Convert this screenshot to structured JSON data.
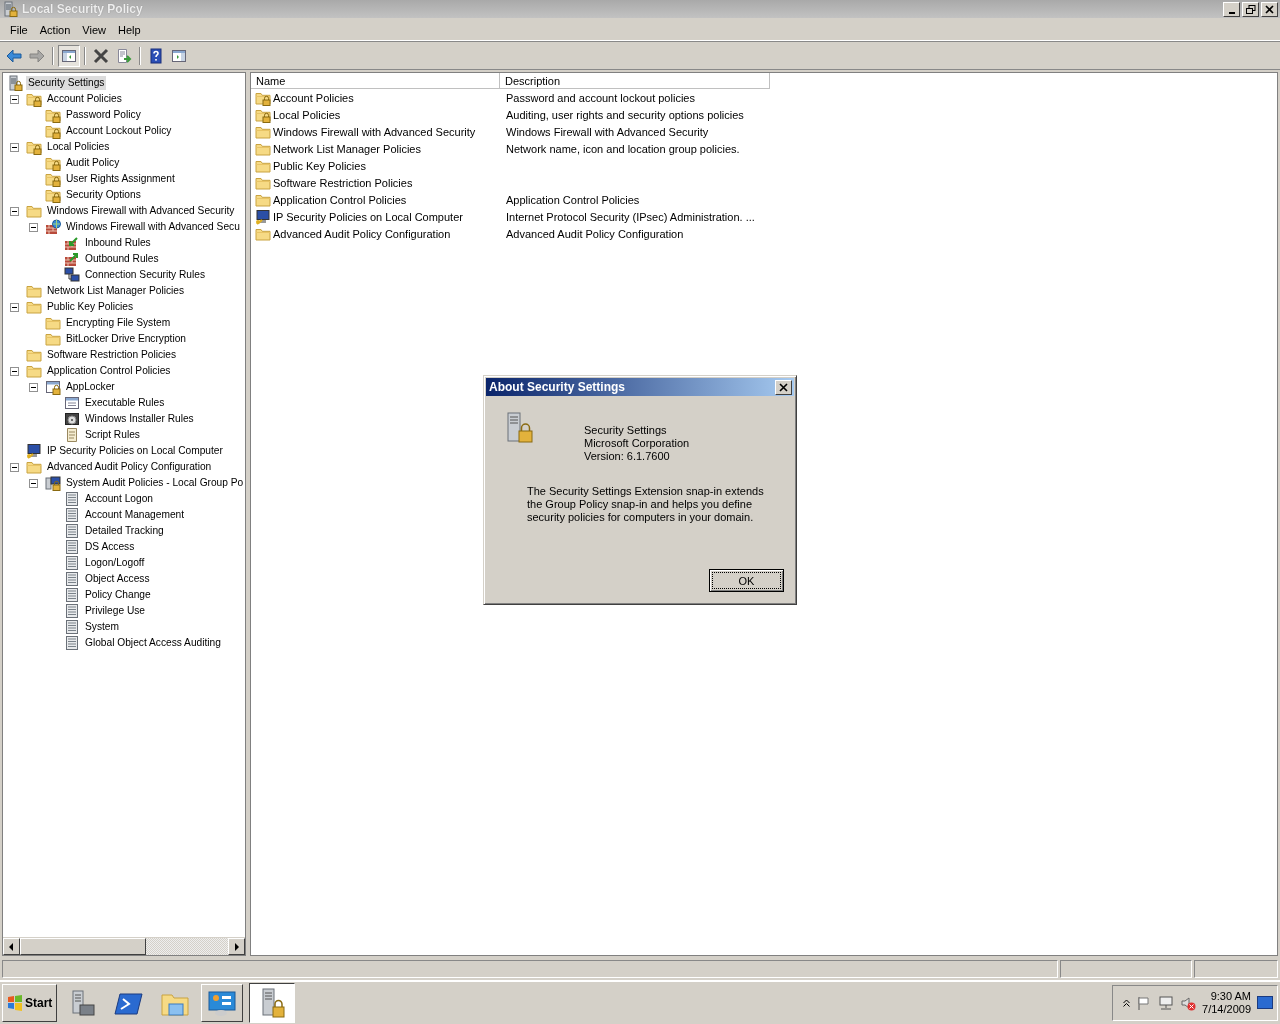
{
  "window": {
    "title": "Local Security Policy"
  },
  "menu": [
    {
      "label": "File"
    },
    {
      "label": "Action"
    },
    {
      "label": "View"
    },
    {
      "label": "Help"
    }
  ],
  "toolbar": [
    {
      "kind": "back",
      "disabled": false,
      "pressed": false
    },
    {
      "kind": "forward",
      "disabled": true,
      "pressed": false
    },
    {
      "kind": "console-tree",
      "disabled": false,
      "pressed": true
    },
    {
      "kind": "delete",
      "disabled": false,
      "pressed": false
    },
    {
      "kind": "export",
      "disabled": false,
      "pressed": false
    },
    {
      "kind": "help",
      "disabled": false,
      "pressed": false
    },
    {
      "kind": "action-pane",
      "disabled": false,
      "pressed": false
    }
  ],
  "tree": [
    {
      "label": "Security Settings",
      "kind": "root",
      "selected": true,
      "children": [
        {
          "label": "Account Policies",
          "kind": "lock-folder",
          "expanded": true,
          "selected": false,
          "children": [
            {
              "label": "Password Policy",
              "kind": "lock-folder",
              "selected": false
            },
            {
              "label": "Account Lockout Policy",
              "kind": "lock-folder",
              "selected": false
            }
          ]
        },
        {
          "label": "Local Policies",
          "kind": "lock-folder",
          "expanded": true,
          "selected": false,
          "children": [
            {
              "label": "Audit Policy",
              "kind": "lock-folder",
              "selected": false
            },
            {
              "label": "User Rights Assignment",
              "kind": "lock-folder",
              "selected": false
            },
            {
              "label": "Security Options",
              "kind": "lock-folder",
              "selected": false
            }
          ]
        },
        {
          "label": "Windows Firewall with Advanced Security",
          "kind": "folder",
          "expanded": true,
          "selected": false,
          "children": [
            {
              "label": "Windows Firewall with Advanced Secu",
              "kind": "firewall",
              "expanded": true,
              "selected": false,
              "children": [
                {
                  "label": "Inbound Rules",
                  "kind": "inbound",
                  "selected": false
                },
                {
                  "label": "Outbound Rules",
                  "kind": "outbound",
                  "selected": false
                },
                {
                  "label": "Connection Security Rules",
                  "kind": "connection",
                  "selected": false
                }
              ]
            }
          ]
        },
        {
          "label": "Network List Manager Policies",
          "kind": "folder",
          "selected": false
        },
        {
          "label": "Public Key Policies",
          "kind": "folder",
          "expanded": true,
          "selected": false,
          "children": [
            {
              "label": "Encrypting File System",
              "kind": "folder",
              "selected": false
            },
            {
              "label": "BitLocker Drive Encryption",
              "kind": "folder",
              "selected": false
            }
          ]
        },
        {
          "label": "Software Restriction Policies",
          "kind": "folder",
          "selected": false
        },
        {
          "label": "Application Control Policies",
          "kind": "folder",
          "expanded": true,
          "selected": false,
          "children": [
            {
              "label": "AppLocker",
              "kind": "applocker",
              "expanded": true,
              "selected": false,
              "children": [
                {
                  "label": "Executable Rules",
                  "kind": "window",
                  "selected": false
                },
                {
                  "label": "Windows Installer Rules",
                  "kind": "disc",
                  "selected": false
                },
                {
                  "label": "Script Rules",
                  "kind": "script",
                  "selected": false
                }
              ]
            }
          ]
        },
        {
          "label": "IP Security Policies on Local Computer",
          "kind": "ipsec",
          "selected": false
        },
        {
          "label": "Advanced Audit Policy Configuration",
          "kind": "folder",
          "expanded": true,
          "selected": false,
          "children": [
            {
              "label": "System Audit Policies - Local Group Po",
              "kind": "audit",
              "expanded": true,
              "selected": false,
              "children": [
                {
                  "label": "Account Logon",
                  "kind": "audit-item",
                  "selected": false
                },
                {
                  "label": "Account Management",
                  "kind": "audit-item",
                  "selected": false
                },
                {
                  "label": "Detailed Tracking",
                  "kind": "audit-item",
                  "selected": false
                },
                {
                  "label": "DS Access",
                  "kind": "audit-item",
                  "selected": false
                },
                {
                  "label": "Logon/Logoff",
                  "kind": "audit-item",
                  "selected": false
                },
                {
                  "label": "Object Access",
                  "kind": "audit-item",
                  "selected": false
                },
                {
                  "label": "Policy Change",
                  "kind": "audit-item",
                  "selected": false
                },
                {
                  "label": "Privilege Use",
                  "kind": "audit-item",
                  "selected": false
                },
                {
                  "label": "System",
                  "kind": "audit-item",
                  "selected": false
                },
                {
                  "label": "Global Object Access Auditing",
                  "kind": "audit-item",
                  "selected": false
                }
              ]
            }
          ]
        }
      ]
    }
  ],
  "list": {
    "columns": [
      {
        "label": "Name"
      },
      {
        "label": "Description"
      }
    ],
    "rows": [
      {
        "name": "Account Policies",
        "kind": "lock-folder",
        "description": "Password and account lockout policies",
        "selected": false
      },
      {
        "name": "Local Policies",
        "kind": "lock-folder",
        "description": "Auditing, user rights and security options policies",
        "selected": false
      },
      {
        "name": "Windows Firewall with Advanced Security",
        "kind": "folder",
        "description": "Windows Firewall with Advanced Security",
        "selected": false
      },
      {
        "name": "Network List Manager Policies",
        "kind": "folder",
        "description": "Network name, icon and location group policies.",
        "selected": false
      },
      {
        "name": "Public Key Policies",
        "kind": "folder",
        "selected": false
      },
      {
        "name": "Software Restriction Policies",
        "kind": "folder",
        "selected": false
      },
      {
        "name": "Application Control Policies",
        "kind": "folder",
        "description": "Application Control Policies",
        "selected": false
      },
      {
        "name": "IP Security Policies on Local Computer",
        "kind": "ipsec",
        "description": "Internet Protocol Security (IPsec) Administration. ...",
        "selected": false
      },
      {
        "name": "Advanced Audit Policy Configuration",
        "kind": "folder",
        "description": "Advanced Audit Policy Configuration",
        "selected": false
      }
    ]
  },
  "dialog": {
    "title": "About Security Settings",
    "product": "Security Settings",
    "company": "Microsoft Corporation",
    "version": "Version: 6.1.7600",
    "description": "The Security Settings Extension snap-in extends the Group Policy snap-in and helps you define security policies for computers in your domain.",
    "ok_button": "OK"
  },
  "taskbar": {
    "start": "Start",
    "time": "9:30 AM",
    "date": "7/14/2009"
  }
}
